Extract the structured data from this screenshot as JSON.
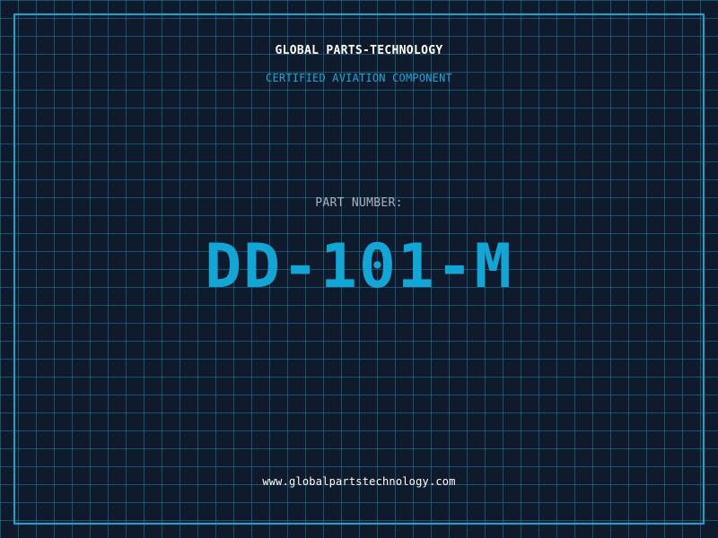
{
  "header": {
    "company": "GLOBAL PARTS-TECHNOLOGY",
    "tagline": "CERTIFIED AVIATION COMPONENT"
  },
  "part": {
    "label": "PART NUMBER:",
    "number": "DD-101-M"
  },
  "footer": {
    "website": "www.globalpartstechnology.com"
  },
  "colors": {
    "background": "#0f1a2d",
    "grid": "#1e82a0",
    "accent": "#12a6d6",
    "border": "#19a4d0"
  }
}
